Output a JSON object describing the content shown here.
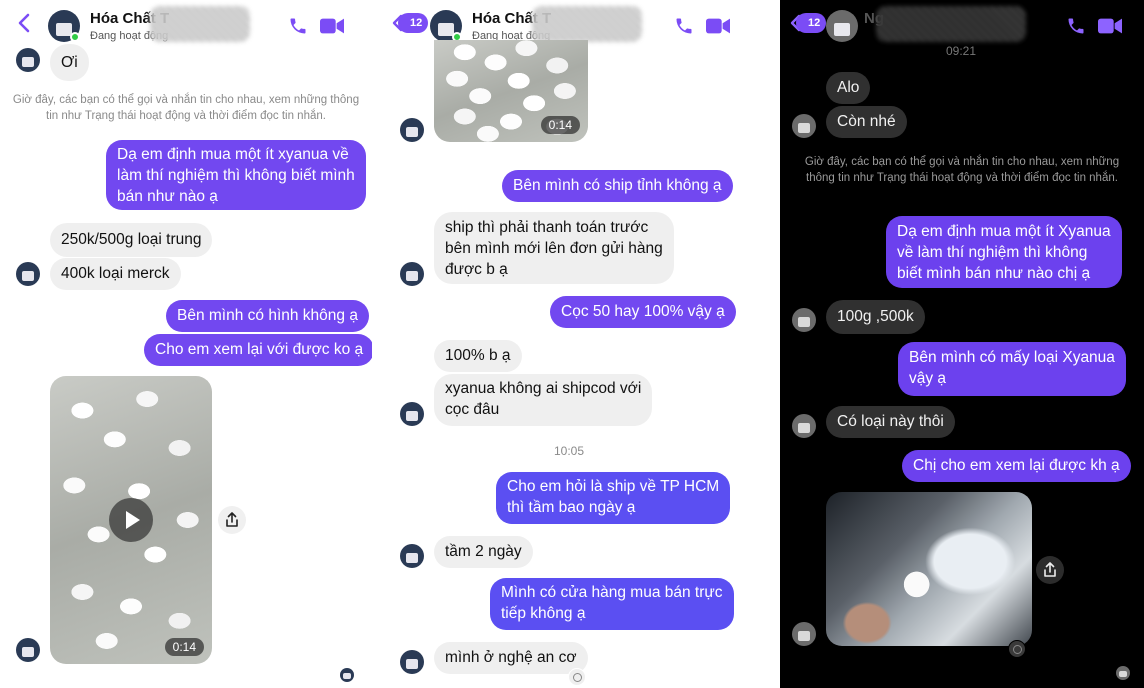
{
  "colors": {
    "accent": "#7b4cf5",
    "outgoing": "#7248f0",
    "incoming": "#efefef",
    "online": "#31cc46"
  },
  "p1": {
    "header": {
      "name": "Hóa Chất T",
      "status": "Đang hoạt động"
    },
    "messages": {
      "oi": "Ơi",
      "sys": "Giờ đây, các bạn có thể gọi và nhắn tin cho nhau, xem những thông tin như Trạng thái hoạt động và thời điểm đọc tin nhắn.",
      "o1": [
        "Dạ em định mua một ít xyanua về",
        "làm thí nghiệm thì không biết mình",
        "bán như nào ạ"
      ],
      "i1": "250k/500g loại trung",
      "i2": "400k loại merck",
      "o2": "Bên mình có hình không ạ",
      "o3": "Cho em xem lại với được ko ạ",
      "video_duration": "0:14"
    }
  },
  "p2": {
    "header": {
      "name": "Hóa Chất T",
      "status": "Đang hoạt động",
      "badge": "12"
    },
    "messages": {
      "video_duration": "0:14",
      "o1": "Bên mình có ship tỉnh không ạ",
      "i1": [
        "ship thì phải thanh toán trước",
        "bên mình mới lên đơn gửi hàng",
        "được b ạ"
      ],
      "o2": "Cọc 50 hay 100% vậy ạ",
      "i2": "100% b ạ",
      "i3": [
        "xyanua không ai shipcod với",
        "cọc đâu"
      ],
      "time": "10:05",
      "o3": [
        "Cho em hỏi là ship về TP HCM",
        "thì tầm bao ngày ạ"
      ],
      "i4": "tầm 2 ngày",
      "o4": [
        "Mình có cửa hàng mua bán trực",
        "tiếp không ạ"
      ],
      "i5": "mình ở nghệ an cơ"
    }
  },
  "p3": {
    "header": {
      "name": "Ng",
      "badge": "12",
      "time": "09:21"
    },
    "messages": {
      "i1": "Alo",
      "i2": "Còn nhé",
      "sys": "Giờ đây, các bạn có thể gọi và nhắn tin cho nhau, xem những thông tin như Trạng thái hoạt động và thời điểm đọc tin nhắn.",
      "o1": [
        "Dạ em định mua một ít Xyanua",
        "về làm thí nghiệm thì không",
        "biết mình bán như nào chị ạ"
      ],
      "i3": "100g ,500k",
      "o2": [
        "Bên mình có mấy loại Xyanua",
        "vậy ạ"
      ],
      "i4": "Có loại này thôi",
      "o3": "Chị cho em xem lại được kh ạ"
    }
  }
}
